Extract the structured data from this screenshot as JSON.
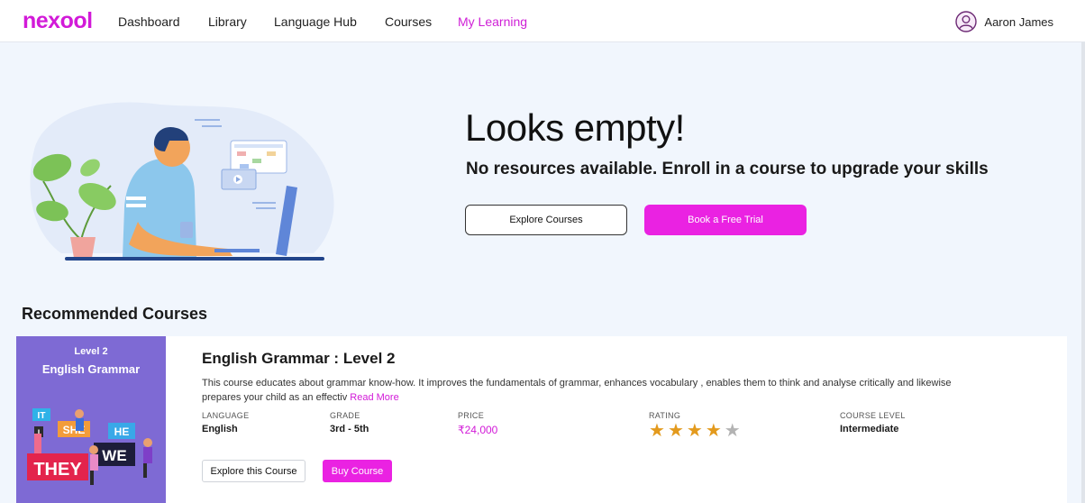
{
  "brand": {
    "logo": "nexool",
    "accent": "#d21ad8"
  },
  "nav": {
    "items": [
      {
        "label": "Dashboard",
        "active": false
      },
      {
        "label": "Library",
        "active": false
      },
      {
        "label": "Language Hub",
        "active": false
      },
      {
        "label": "Courses",
        "active": false
      },
      {
        "label": "My Learning",
        "active": true
      }
    ],
    "user": {
      "name": "Aaron James",
      "icon": "user-avatar-icon"
    }
  },
  "hero": {
    "title": "Looks empty!",
    "subtitle": "No resources available. Enroll in a course to upgrade your skills",
    "explore_label": "Explore Courses",
    "trial_label": "Book a Free Trial"
  },
  "recommended": {
    "title": "Recommended Courses",
    "courses": [
      {
        "thumb_level": "Level 2",
        "thumb_title": "English Grammar",
        "thumb_words": [
          "IT",
          "I",
          "SHE",
          "HE",
          "WE",
          "THEY"
        ],
        "title": "English Grammar : Level 2",
        "description": "This course educates about grammar know-how. It improves the fundamentals of grammar, enhances vocabulary , enables them to think and analyse critically and likewise prepares your child as an effectiv",
        "read_more": "Read More",
        "language_label": "LANGUAGE",
        "language": "English",
        "grade_label": "GRADE",
        "grade": "3rd - 5th",
        "price_label": "PRICE",
        "price": "₹24,000",
        "rating_label": "RATING",
        "rating": 4,
        "rating_max": 5,
        "level_label": "COURSE LEVEL",
        "level": "Intermediate",
        "explore_label": "Explore this Course",
        "buy_label": "Buy Course"
      }
    ]
  }
}
